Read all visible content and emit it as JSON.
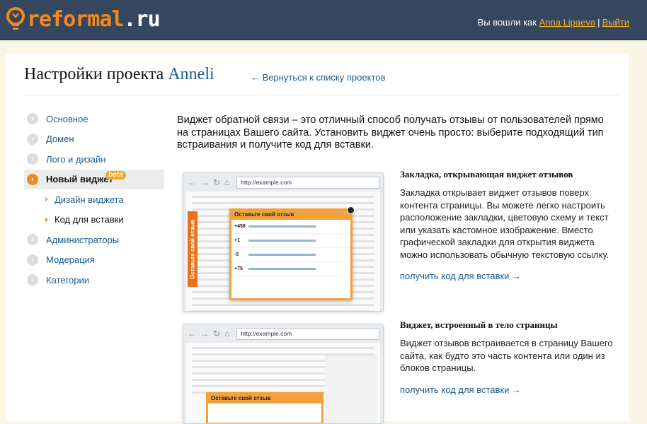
{
  "header": {
    "logo": {
      "brand": "reformal",
      "tld": ".ru",
      "icon": "lightbulb-icon"
    },
    "user": {
      "prefix": "Вы вошли как",
      "name": "Anna Lipaeva",
      "separator": "|",
      "logout": "Выйти"
    }
  },
  "page": {
    "title_prefix": "Настройки проекта",
    "project_name": "Anneli",
    "back_link": "← Вернуться к списку проектов"
  },
  "sidebar": {
    "items": [
      {
        "label": "Основное"
      },
      {
        "label": "Домен"
      },
      {
        "label": "Лого и дизайн"
      },
      {
        "label": "Новый виджет",
        "badge": "beta",
        "active": true
      },
      {
        "label": "Администраторы"
      },
      {
        "label": "Модерация"
      },
      {
        "label": "Категории"
      }
    ],
    "subitems": [
      {
        "label": "Дизайн виджета"
      },
      {
        "label": "Код для вставки",
        "current": true
      }
    ]
  },
  "main": {
    "intro": "Виджет обратной связи – это отличный способ получать отзывы от пользователей прямо на страницах Вашего сайта. Установить виджет очень просто: выберите подходящий тип встраивания и получите код для вставки.",
    "options": [
      {
        "title": "Закладка, открывающая виджет отзывов",
        "description": "Закладка открывает виджет отзывов поверх контента страницы. Вы можете легко настроить расположение закладки, цветовую схему и текст или указать кастомное изображение. Вместо графической закладки для открытия виджета можно использовать обычную текстовую ссылку.",
        "link": "получить код для вставки →"
      },
      {
        "title": "Виджет, встроенный в тело страницы",
        "description": "Виджет отзывов встраивается в страницу Вашего сайта, как будто это часть контента или один из блоков страницы.",
        "link": "получить код для вставки →"
      }
    ],
    "illustration": {
      "address": "http://example.com",
      "tab_label": "Оставьте свой отзыв",
      "popup_title": "Оставьте свой отзыв",
      "votes": [
        "+458",
        "+1",
        "-5",
        "+75"
      ]
    }
  },
  "colors": {
    "header_bg": "#35465f",
    "brand_orange": "#f28a1b",
    "link_blue": "#1d5a8c",
    "user_link": "#f5b32c",
    "page_bg": "#faf6e6"
  }
}
